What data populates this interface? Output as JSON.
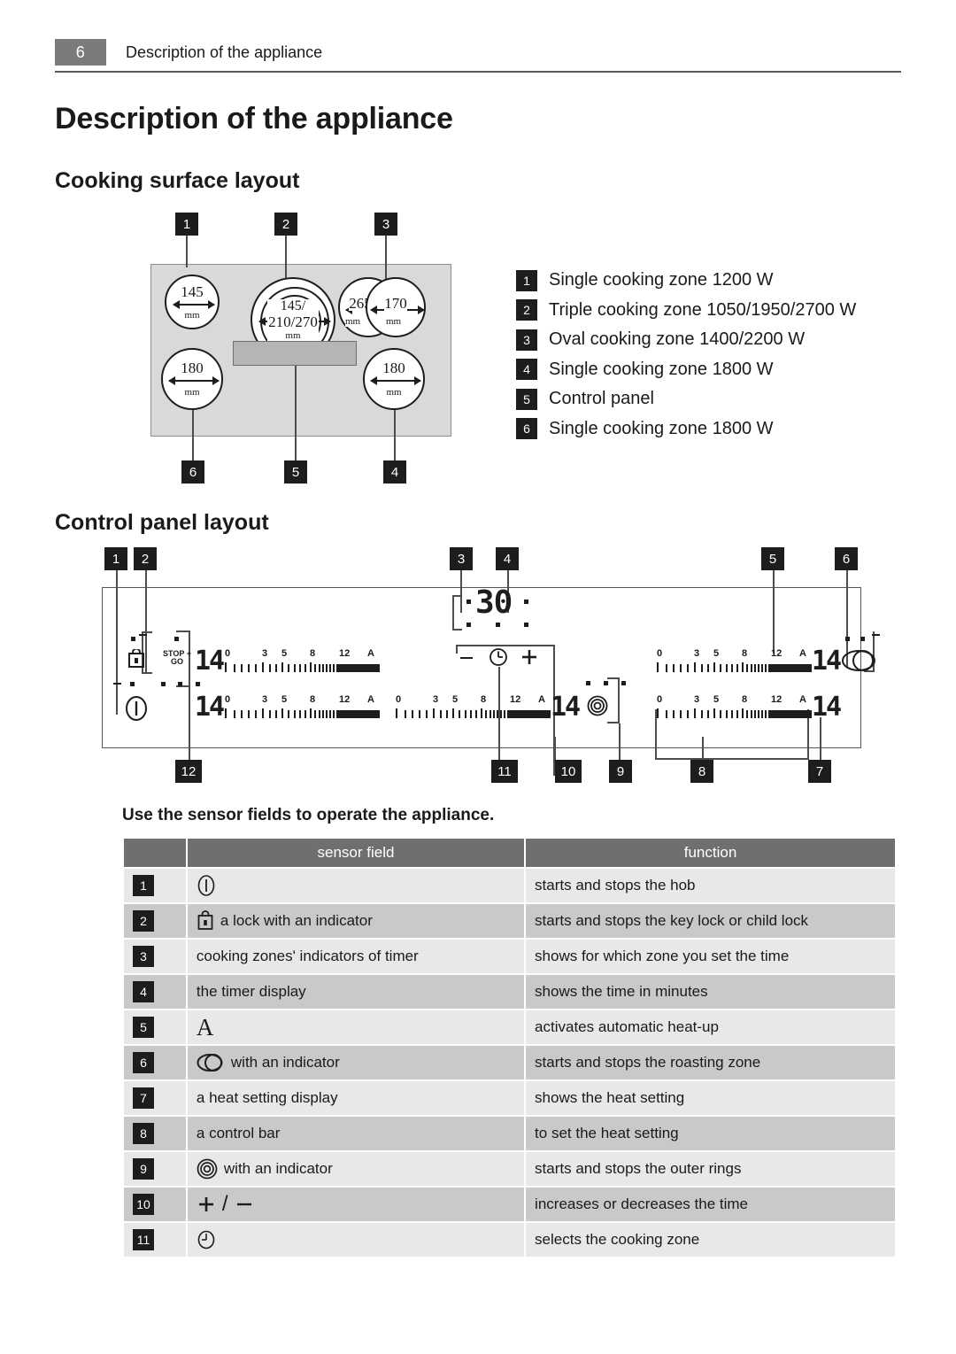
{
  "header": {
    "page_number": "6",
    "running_title": "Description of the appliance"
  },
  "doc_title": "Description of the appliance",
  "sections": {
    "cooking_surface": "Cooking surface layout",
    "control_panel": "Control panel layout"
  },
  "cooking_surface": {
    "callouts_top": [
      "1",
      "2",
      "3"
    ],
    "callouts_bottom": [
      "6",
      "5",
      "4"
    ],
    "zones": [
      {
        "id": "zone-1",
        "diameter": "145",
        "unit": "mm"
      },
      {
        "id": "zone-2",
        "diameter_line1": "145/",
        "diameter_line2": "210/270",
        "unit": "mm"
      },
      {
        "id": "zone-3-outer",
        "diameter": "265",
        "unit": "mm"
      },
      {
        "id": "zone-3-inner",
        "diameter": "170",
        "unit": "mm"
      },
      {
        "id": "zone-6",
        "diameter": "180",
        "unit": "mm"
      },
      {
        "id": "zone-4",
        "diameter": "180",
        "unit": "mm"
      }
    ],
    "legend": [
      {
        "num": "1",
        "text": "Single cooking zone 1200 W"
      },
      {
        "num": "2",
        "text": "Triple cooking zone 1050/1950/2700 W"
      },
      {
        "num": "3",
        "text": "Oval cooking zone 1400/2200 W"
      },
      {
        "num": "4",
        "text": "Single cooking zone 1800 W"
      },
      {
        "num": "5",
        "text": "Control panel"
      },
      {
        "num": "6",
        "text": "Single cooking zone 1800 W"
      }
    ]
  },
  "control_panel": {
    "callouts_top": [
      "1",
      "2",
      "3",
      "4",
      "5",
      "6"
    ],
    "callouts_bottom": [
      "12",
      "11",
      "10",
      "9",
      "8",
      "7"
    ],
    "stop_go_label": "STOP + GO",
    "timer_value": "30",
    "heat_displays": [
      "14",
      "14",
      "14",
      "14",
      "14"
    ],
    "control_bar_scale": [
      "0",
      "3",
      "5",
      "8",
      "12",
      "A"
    ],
    "icons": {
      "power": "power-icon",
      "lock": "lock-icon",
      "timer_clock": "clock-icon",
      "minus": "–",
      "plus": "+",
      "roasting_zone": "roasting-zone-icon",
      "outer_rings": "outer-rings-icon"
    }
  },
  "sensor_section": {
    "intro": "Use the sensor fields to operate the appliance.",
    "headers": {
      "num": "",
      "sensor": "sensor field",
      "function": "function"
    },
    "rows": [
      {
        "num": "1",
        "sensor_icon": "power-icon",
        "sensor": "",
        "function": "starts and stops the hob"
      },
      {
        "num": "2",
        "sensor_icon": "lock-icon",
        "sensor": "a lock with an indicator",
        "function": "starts and stops the key lock or child lock"
      },
      {
        "num": "3",
        "sensor_icon": "",
        "sensor": "cooking zones' indicators of timer",
        "function": "shows for which zone you set the time"
      },
      {
        "num": "4",
        "sensor_icon": "",
        "sensor": "the timer display",
        "function": "shows the time in minutes"
      },
      {
        "num": "5",
        "sensor_icon": "letter-a",
        "sensor": "",
        "function": "activates automatic heat-up"
      },
      {
        "num": "6",
        "sensor_icon": "roasting-zone-icon",
        "sensor": "with an indicator",
        "function": "starts and stops the roasting zone"
      },
      {
        "num": "7",
        "sensor_icon": "",
        "sensor": "a heat setting display",
        "function": "shows the heat setting"
      },
      {
        "num": "8",
        "sensor_icon": "",
        "sensor": "a control bar",
        "function": "to set the heat setting"
      },
      {
        "num": "9",
        "sensor_icon": "outer-rings-icon",
        "sensor": "with an indicator",
        "function": "starts and stops the outer rings"
      },
      {
        "num": "10",
        "sensor_icon": "plus-minus",
        "sensor": "",
        "function": "increases or decreases the time"
      },
      {
        "num": "11",
        "sensor_icon": "clock-icon",
        "sensor": "",
        "function": "selects the cooking zone"
      }
    ]
  }
}
